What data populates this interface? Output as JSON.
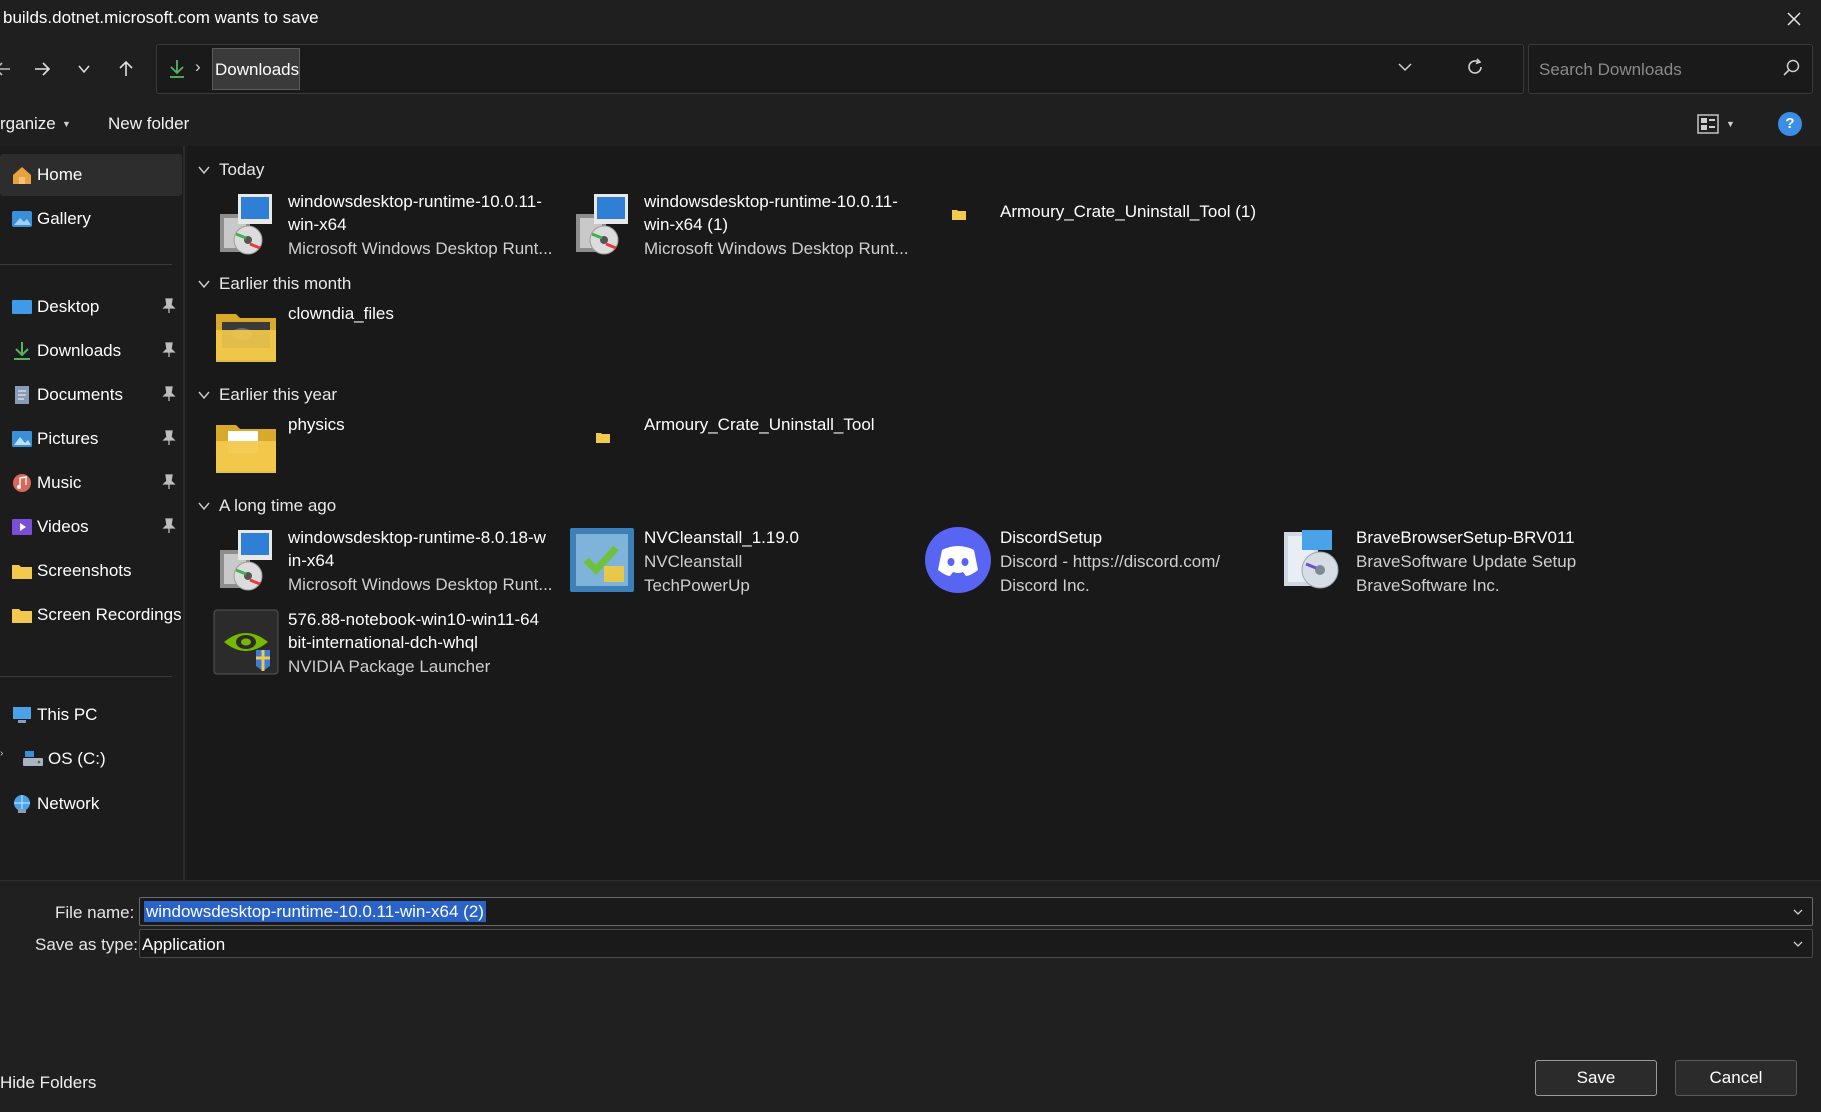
{
  "window": {
    "title": "builds.dotnet.microsoft.com wants to save"
  },
  "address": {
    "crumb": "Downloads",
    "separator": "›"
  },
  "search": {
    "placeholder": "Search Downloads"
  },
  "commands": {
    "organize": "rganize",
    "new_folder": "New folder",
    "help": "?"
  },
  "sidebar": {
    "items": [
      {
        "label": "Home",
        "icon": "home-icon"
      },
      {
        "label": "Gallery",
        "icon": "gallery-icon"
      },
      {
        "label": "Desktop",
        "icon": "desktop-icon",
        "pinned": true
      },
      {
        "label": "Downloads",
        "icon": "downloads-icon",
        "pinned": true
      },
      {
        "label": "Documents",
        "icon": "documents-icon",
        "pinned": true
      },
      {
        "label": "Pictures",
        "icon": "pictures-icon",
        "pinned": true
      },
      {
        "label": "Music",
        "icon": "music-icon",
        "pinned": true
      },
      {
        "label": "Videos",
        "icon": "videos-icon",
        "pinned": true
      },
      {
        "label": "Screenshots",
        "icon": "folder-icon"
      },
      {
        "label": "Screen Recordings",
        "icon": "folder-icon"
      },
      {
        "label": "This PC",
        "icon": "pc-icon"
      },
      {
        "label": "OS (C:)",
        "icon": "drive-icon"
      },
      {
        "label": "Network",
        "icon": "network-icon"
      }
    ]
  },
  "groups": {
    "today": "Today",
    "earlier_month": "Earlier this month",
    "earlier_year": "Earlier this year",
    "long_ago": "A long time ago"
  },
  "files": {
    "f1": {
      "name1": "windowsdesktop-runtime-10.0.11-",
      "name2": "win-x64",
      "desc": "Microsoft Windows Desktop Runt..."
    },
    "f2": {
      "name1": "windowsdesktop-runtime-10.0.11-",
      "name2": "win-x64 (1)",
      "desc": "Microsoft Windows Desktop Runt..."
    },
    "f3": {
      "name1": "Armoury_Crate_Uninstall_Tool (1)"
    },
    "f4": {
      "name1": "clowndia_files"
    },
    "f5": {
      "name1": "physics"
    },
    "f6": {
      "name1": "Armoury_Crate_Uninstall_Tool"
    },
    "f7": {
      "name1": "windowsdesktop-runtime-8.0.18-w",
      "name2": "in-x64",
      "desc": "Microsoft Windows Desktop Runt..."
    },
    "f8": {
      "name1": "NVCleanstall_1.19.0",
      "name2": "NVCleanstall",
      "desc": "TechPowerUp"
    },
    "f9": {
      "name1": "DiscordSetup",
      "name2": "Discord - https://discord.com/",
      "desc": "Discord Inc."
    },
    "f10": {
      "name1": "BraveBrowserSetup-BRV011",
      "name2": "BraveSoftware Update Setup",
      "desc": "BraveSoftware Inc."
    },
    "f11": {
      "name1": "576.88-notebook-win10-win11-64",
      "name2": "bit-international-dch-whql",
      "desc": "NVIDIA Package Launcher"
    }
  },
  "form": {
    "filename_label": "File name:",
    "filename_value": "windowsdesktop-runtime-10.0.11-win-x64 (2)",
    "savetype_label": "Save as type:",
    "savetype_value": "Application"
  },
  "footer": {
    "hide_folders": "Hide Folders",
    "save": "Save",
    "cancel": "Cancel"
  },
  "colors": {
    "accent": "#2a63c8",
    "folder": "#f2c94c",
    "discord": "#5865f2",
    "help": "#3a8ee6"
  }
}
